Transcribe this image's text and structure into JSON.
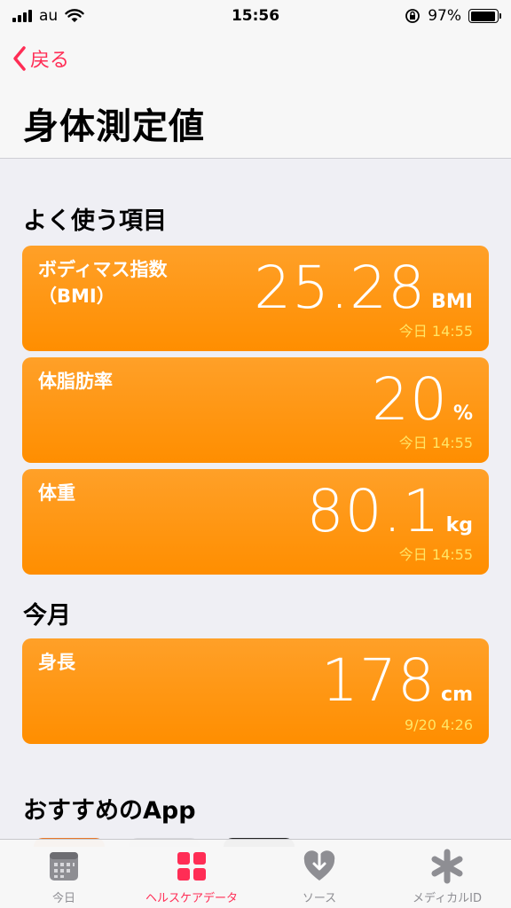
{
  "status_bar": {
    "carrier": "au",
    "time": "15:56",
    "battery": "97%",
    "battery_level": 0.97
  },
  "nav": {
    "back_label": "戻る",
    "title": "身体測定値"
  },
  "sections": {
    "favorites_header": "よく使う項目",
    "this_month_header": "今月",
    "recommended_header": "おすすめのApp"
  },
  "cards": {
    "bmi": {
      "label": "ボディマス指数\n（BMI）",
      "value": "25.28",
      "unit": "BMI",
      "time": "今日 14:55"
    },
    "body_fat": {
      "label": "体脂肪率",
      "value": "20",
      "unit": "%",
      "time": "今日 14:55"
    },
    "weight": {
      "label": "体重",
      "value": "80.1",
      "unit": "kg",
      "time": "今日 14:55"
    },
    "height": {
      "label": "身長",
      "value": "178",
      "unit": "cm",
      "time": "9/20 4:26"
    }
  },
  "tab_bar": {
    "today": "今日",
    "health_data": "ヘルスケアデータ",
    "sources": "ソース",
    "medical_id": "メディカルID"
  },
  "colors": {
    "accent": "#ff2d55",
    "card_orange": "#ff9500",
    "time_yellow": "#ffe566"
  }
}
